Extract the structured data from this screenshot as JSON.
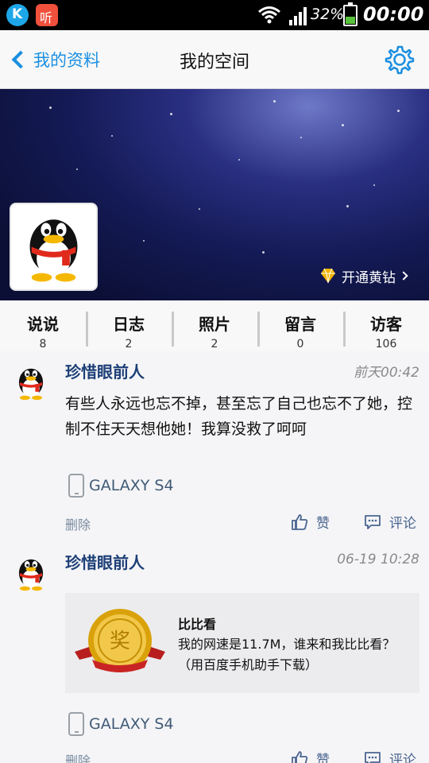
{
  "status_bar": {
    "apps": [
      {
        "icon": "k-app-icon",
        "label": "K"
      },
      {
        "icon": "listen-app-icon",
        "label": "听"
      }
    ],
    "battery_text": "32%",
    "time": "00:00"
  },
  "nav": {
    "back_label": "我的资料",
    "title": "我的空间"
  },
  "banner": {
    "vip_label": "开通黄钻"
  },
  "stats": [
    {
      "label": "说说",
      "count": "8"
    },
    {
      "label": "日志",
      "count": "2"
    },
    {
      "label": "照片",
      "count": "2"
    },
    {
      "label": "留言",
      "count": "0"
    },
    {
      "label": "访客",
      "count": "106"
    }
  ],
  "posts": [
    {
      "author": "珍惜眼前人",
      "time": "前天00:42",
      "text": "有些人永远也忘不掉，甚至忘了自己也忘不了她，控制不住天天想他她！我算没救了呵呵",
      "device": "GALAXY S4",
      "delete": "删除",
      "like": "赞",
      "comment": "评论"
    },
    {
      "author": "珍惜眼前人",
      "time": "06-19 10:28",
      "share_title": "比比看",
      "share_desc": "我的网速是11.7M，谁来和我比比看？（用百度手机助手下载）",
      "medal_text": "奖",
      "device": "GALAXY S4",
      "delete": "删除",
      "like": "赞",
      "comment": "评论"
    }
  ],
  "colors": {
    "accent": "#1a8fe0",
    "author": "#1d3f77",
    "banner": "#141a55"
  }
}
